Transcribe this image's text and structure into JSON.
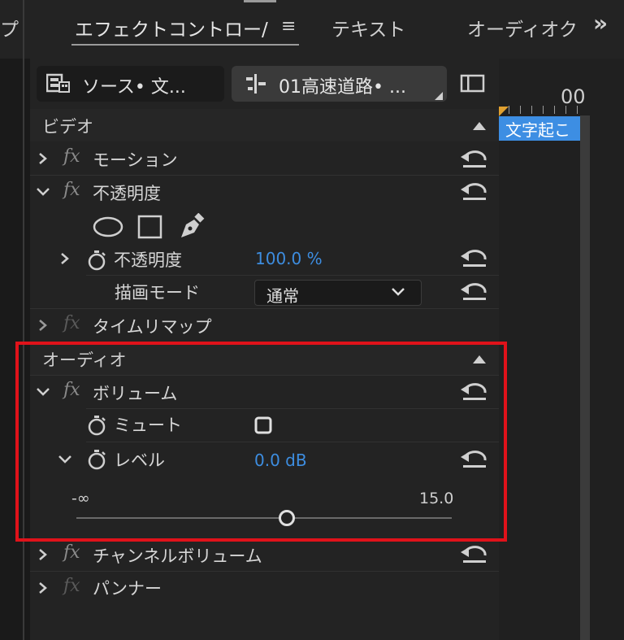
{
  "tabs": [
    {
      "label": "プ"
    },
    {
      "label": "エフェクトコントロー/"
    },
    {
      "label": "テキスト"
    },
    {
      "label": "オーディオク"
    }
  ],
  "tab_menu_glyph": "≡",
  "overflow_glyph": "»",
  "source_selector": {
    "label": "ソース• 文..."
  },
  "clip_selector": {
    "label": "01高速道路• ..."
  },
  "timeline": {
    "time_label": "00",
    "clip_label": "文字起こ"
  },
  "video_section": {
    "title": "ビデオ",
    "effects": [
      {
        "label": "モーション"
      },
      {
        "label": "不透明度"
      }
    ],
    "opacity_param": {
      "label": "不透明度",
      "value": "100.0 %"
    },
    "blend_mode": {
      "label": "描画モード",
      "value": "通常"
    },
    "time_remap": {
      "label": "タイムリマップ"
    }
  },
  "audio_section": {
    "title": "オーディオ",
    "volume": {
      "label": "ボリューム"
    },
    "mute": {
      "label": "ミュート"
    },
    "level": {
      "label": "レベル",
      "value": "0.0 dB"
    },
    "slider": {
      "min_label": "-∞",
      "max_label": "15.0"
    },
    "channel_volume": {
      "label": "チャンネルボリューム"
    },
    "panner": {
      "label": "パンナー"
    }
  },
  "colors": {
    "accent_blue": "#3d8de0",
    "highlight_red": "#e0121a",
    "marker_blue": "#3d8ee3"
  }
}
